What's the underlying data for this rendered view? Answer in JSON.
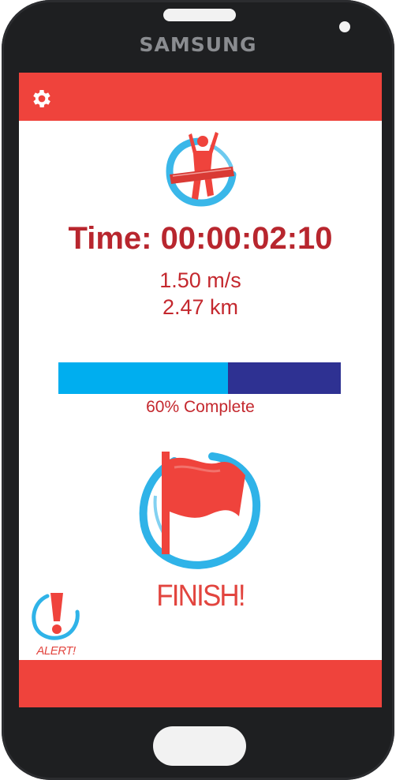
{
  "device": {
    "brand": "SAMSUNG"
  },
  "toolbar": {
    "settings_icon": "gear-icon"
  },
  "stats": {
    "time": "Time: 00:00:02:10",
    "speed": "1.50 m/s",
    "distance": "2.47 km"
  },
  "progress": {
    "percent": 60,
    "label": "60% Complete"
  },
  "actions": {
    "finish_label": "FINISH!",
    "finish_icon": "flag-icon",
    "alert_label": "ALERT!",
    "alert_icon": "exclamation-icon"
  },
  "colors": {
    "bar": "#ef433c",
    "text_red": "#c4282e",
    "progress_fill": "#00aeef",
    "progress_track": "#2e3192",
    "ring_blue": "#2fb3e8"
  }
}
